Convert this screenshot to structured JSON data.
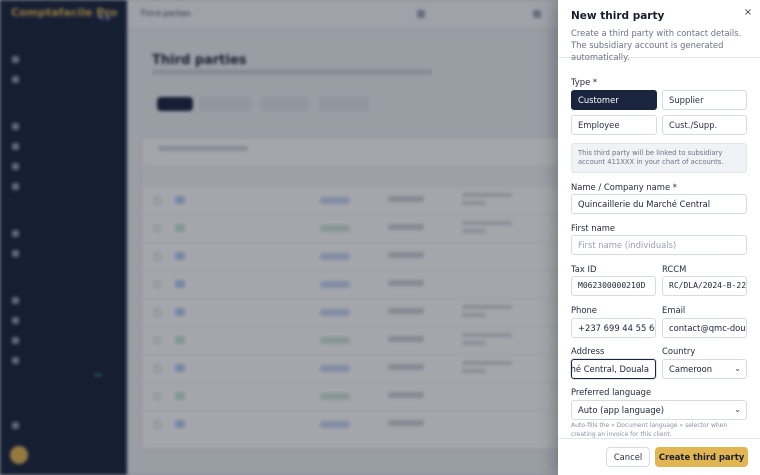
{
  "app": {
    "brand": "Comptafacile Pro",
    "topbar_title": "Third parties",
    "page_title": "Third parties"
  },
  "drawer": {
    "title": "New third party",
    "description": "Create a third party with contact details. The subsidiary account is generated automatically.",
    "type": {
      "label": "Type *",
      "options": [
        "Customer",
        "Supplier",
        "Employee",
        "Cust./Supp."
      ],
      "selected": "Customer"
    },
    "info": "This third party will be linked to subsidiary account 411XXX in your chart of accounts.",
    "name": {
      "label": "Name / Company name *",
      "value": "Quincaillerie du Marché Central"
    },
    "first_name": {
      "label": "First name",
      "placeholder": "First name (individuals)"
    },
    "tax_id": {
      "label": "Tax ID",
      "value": "M062300000210D"
    },
    "rccm": {
      "label": "RCCM",
      "value": "RC/DLA/2024-B-22"
    },
    "phone": {
      "label": "Phone",
      "value": "+237 699 44 55 66"
    },
    "email": {
      "label": "Email",
      "value": "contact@qmc-douala"
    },
    "address": {
      "label": "Address",
      "value": "ché Central, Douala"
    },
    "country": {
      "label": "Country",
      "value": "Cameroon"
    },
    "language": {
      "label": "Preferred language",
      "value": "Auto (app language)"
    },
    "hint": "Auto-fills the « Document language » selector when creating an invoice for this client.",
    "cancel_label": "Cancel",
    "create_label": "Create third party",
    "close_glyph": "×"
  },
  "colors": {
    "navy": "#1a2540",
    "accent": "#e1b552"
  }
}
